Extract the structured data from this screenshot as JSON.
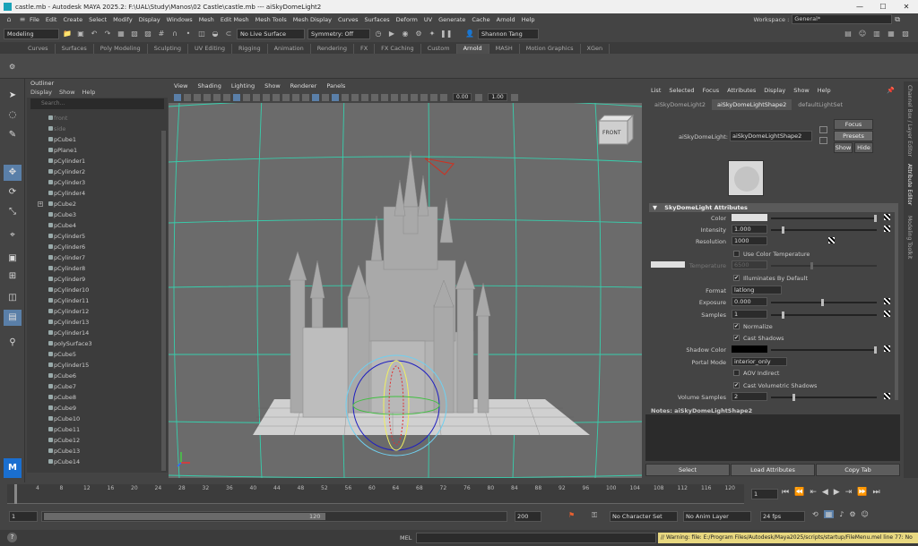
{
  "titlebar": {
    "title": "castle.mb - Autodesk MAYA 2025.2: F:\\UAL\\Study\\Manos\\02 Castle\\castle.mb   ---   aiSkyDomeLight2"
  },
  "menubar": {
    "items": [
      "File",
      "Edit",
      "Create",
      "Select",
      "Modify",
      "Display",
      "Windows",
      "Mesh",
      "Edit Mesh",
      "Mesh Tools",
      "Mesh Display",
      "Curves",
      "Surfaces",
      "Deform",
      "UV",
      "Generate",
      "Cache",
      "Arnold",
      "Help"
    ],
    "workspace_label": "Workspace :",
    "workspace_value": "General*"
  },
  "statusline": {
    "mode": "Modeling",
    "live_surface": "No Live Surface",
    "symmetry": "Symmetry: Off",
    "user": "Shannon Tang"
  },
  "shelf": {
    "tabs": [
      "Curves",
      "Surfaces",
      "Poly Modeling",
      "Sculpting",
      "UV Editing",
      "Rigging",
      "Animation",
      "Rendering",
      "FX",
      "FX Caching",
      "Custom",
      "Arnold",
      "MASH",
      "Motion Graphics",
      "XGen"
    ],
    "active": "Arnold"
  },
  "outliner": {
    "title": "Outliner",
    "menu": [
      "Display",
      "Show",
      "Help"
    ],
    "search_placeholder": "Search...",
    "items": [
      "front",
      "side",
      "pCube1",
      "pPlane1",
      "pCylinder1",
      "pCylinder2",
      "pCylinder3",
      "pCylinder4",
      "pCube2",
      "pCube3",
      "pCube4",
      "pCylinder5",
      "pCylinder6",
      "pCylinder7",
      "pCylinder8",
      "pCylinder9",
      "pCylinder10",
      "pCylinder11",
      "pCylinder12",
      "pCylinder13",
      "pCylinder14",
      "polySurface3",
      "pCube5",
      "pCylinder15",
      "pCube6",
      "pCube7",
      "pCube8",
      "pCube9",
      "pCube10",
      "pCube11",
      "pCube12",
      "pCube13",
      "pCube14"
    ]
  },
  "viewport": {
    "menu": [
      "View",
      "Shading",
      "Lighting",
      "Show",
      "Renderer",
      "Panels"
    ],
    "field1": "0.00",
    "field2": "1.00",
    "cube_label": "FRONT"
  },
  "attr": {
    "menu": [
      "List",
      "Selected",
      "Focus",
      "Attributes",
      "Display",
      "Show",
      "Help"
    ],
    "tabs": [
      "aiSkyDomeLight2",
      "aiSkyDomeLightShape2",
      "defaultLightSet"
    ],
    "node_label": "aiSkyDomeLight:",
    "node_value": "aiSkyDomeLightShape2",
    "focus": "Focus",
    "presets": "Presets",
    "show": "Show",
    "hide": "Hide",
    "section": "SkyDomeLight Attributes",
    "color": "Color",
    "intensity": "Intensity",
    "intensity_val": "1.000",
    "resolution": "Resolution",
    "resolution_val": "1000",
    "use_color_temp": "Use Color Temperature",
    "temperature": "Temperature",
    "temperature_val": "6500",
    "illuminates": "Illuminates By Default",
    "format": "Format",
    "format_val": "latlong",
    "exposure": "Exposure",
    "exposure_val": "0.000",
    "samples": "Samples",
    "samples_val": "1",
    "normalize": "Normalize",
    "cast_shadows": "Cast Shadows",
    "shadow_color": "Shadow Color",
    "portal_mode": "Portal Mode",
    "portal_val": "interior_only",
    "aov_indirect": "AOV Indirect",
    "cast_vol": "Cast Volumetric Shadows",
    "vol_samples": "Volume Samples",
    "vol_samples_val": "2",
    "notes": "Notes:  aiSkyDomeLightShape2",
    "btn_select": "Select",
    "btn_load": "Load Attributes",
    "btn_copy": "Copy Tab"
  },
  "sidetabs": [
    "Channel Box / Layer Editor",
    "Attribute Editor",
    "Modeling Toolkit"
  ],
  "timeslider": {
    "ticks": [
      "4",
      "8",
      "12",
      "16",
      "20",
      "24",
      "28",
      "32",
      "36",
      "40",
      "44",
      "48",
      "52",
      "56",
      "60",
      "64",
      "68",
      "72",
      "76",
      "80",
      "84",
      "88",
      "92",
      "96",
      "100",
      "104",
      "108",
      "112",
      "116",
      "120"
    ],
    "current": "1"
  },
  "range": {
    "start": "1",
    "inner_start": "1",
    "inner_end": "120",
    "end": "120",
    "max": "200",
    "char_set": "No Character Set",
    "anim_layer": "No Anim Layer",
    "fps": "24 fps"
  },
  "cmdline": {
    "label": "MEL",
    "warning": "// Warning: file: E:/Program Files/Autodesk/Maya2025/scripts/startup/FileMenu.mel line 77: No"
  }
}
